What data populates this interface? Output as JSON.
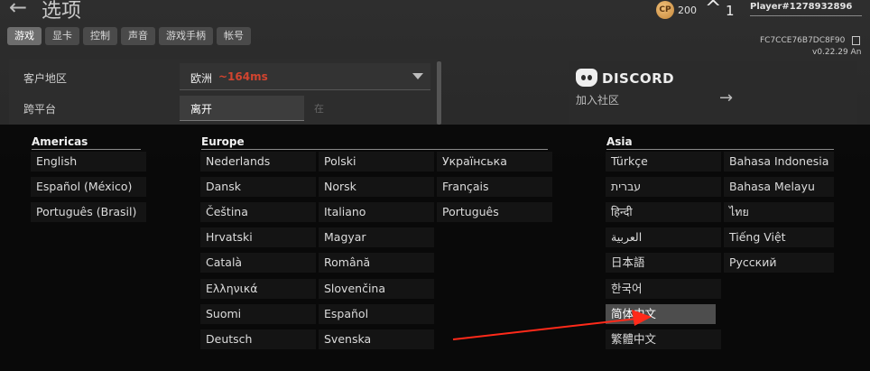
{
  "header": {
    "title": "选项",
    "cp_amount": "200",
    "cp_badge": "CP",
    "level": "1",
    "player_name": "Player#1278932896",
    "player_id": "FC7CCE76B7DC8F90",
    "version": "v0.22.29 An"
  },
  "tabs": [
    "游戏",
    "显卡",
    "控制",
    "声音",
    "游戏手柄",
    "帐号"
  ],
  "settings": {
    "region_label": "客户地区",
    "region_value": "欧洲",
    "region_ping": "~164ms",
    "crossplay_label": "跨平台",
    "crossplay_button": "离开",
    "crossplay_side": "在"
  },
  "discord": {
    "brand": "DISCORD",
    "join": "加入社区",
    "arrow": "→"
  },
  "language_menu": {
    "americas": {
      "heading": "Americas",
      "items": [
        "English",
        "Español (México)",
        "Português (Brasil)"
      ]
    },
    "europe": {
      "heading": "Europe",
      "col1": [
        "Nederlands",
        "Dansk",
        "Čeština",
        "Hrvatski",
        "Català",
        "Ελληνικά",
        "Suomi",
        "Deutsch"
      ],
      "col2": [
        "Polski",
        "Norsk",
        "Italiano",
        "Magyar",
        "Română",
        "Slovenčina",
        "Español",
        "Svenska"
      ],
      "col3": [
        "Українська",
        "Français",
        "Português"
      ]
    },
    "asia": {
      "heading": "Asia",
      "col1": [
        "Türkçe",
        "עברית",
        "हिन्दी",
        "العربية",
        "日本語",
        "한국어",
        "简体中文",
        "繁體中文"
      ],
      "col2": [
        "Bahasa Indonesia",
        "Bahasa Melayu",
        "ไทย",
        "Tiếng Việt",
        "Русский"
      ]
    },
    "selected": "简体中文"
  },
  "colors": {
    "ping": "#d2442f",
    "annotation_arrow": "#ff2a1a",
    "selected_bg": "#4d4d4d"
  }
}
